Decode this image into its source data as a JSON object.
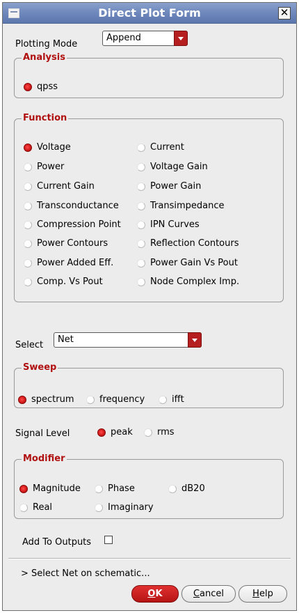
{
  "window": {
    "title": "Direct Plot Form",
    "close_glyph": "✕",
    "menu_icon": "window-menu-icon",
    "close_icon": "close-icon"
  },
  "plotting_mode": {
    "label": "Plotting Mode",
    "value": "Append"
  },
  "analysis": {
    "title": "Analysis",
    "options": [
      {
        "label": "qpss",
        "selected": true
      }
    ]
  },
  "function": {
    "title": "Function",
    "options": [
      {
        "label": "Voltage",
        "selected": true
      },
      {
        "label": "Current",
        "selected": false
      },
      {
        "label": "Power",
        "selected": false
      },
      {
        "label": "Voltage Gain",
        "selected": false
      },
      {
        "label": "Current Gain",
        "selected": false
      },
      {
        "label": "Power Gain",
        "selected": false
      },
      {
        "label": "Transconductance",
        "selected": false
      },
      {
        "label": "Transimpedance",
        "selected": false
      },
      {
        "label": "Compression Point",
        "selected": false
      },
      {
        "label": "IPN Curves",
        "selected": false
      },
      {
        "label": "Power Contours",
        "selected": false
      },
      {
        "label": "Reflection Contours",
        "selected": false
      },
      {
        "label": "Power Added Eff.",
        "selected": false
      },
      {
        "label": "Power Gain Vs Pout",
        "selected": false
      },
      {
        "label": "Comp. Vs Pout",
        "selected": false
      },
      {
        "label": "Node Complex Imp.",
        "selected": false
      }
    ]
  },
  "select": {
    "label": "Select",
    "value": "Net"
  },
  "sweep": {
    "title": "Sweep",
    "options": [
      {
        "label": "spectrum",
        "selected": true
      },
      {
        "label": "frequency",
        "selected": false
      },
      {
        "label": "ifft",
        "selected": false
      }
    ]
  },
  "signal_level": {
    "label": "Signal Level",
    "options": [
      {
        "label": "peak",
        "selected": true
      },
      {
        "label": "rms",
        "selected": false
      }
    ]
  },
  "modifier": {
    "title": "Modifier",
    "options": [
      {
        "label": "Magnitude",
        "selected": true
      },
      {
        "label": "Phase",
        "selected": false
      },
      {
        "label": "dB20",
        "selected": false
      },
      {
        "label": "Real",
        "selected": false
      },
      {
        "label": "Imaginary",
        "selected": false
      }
    ]
  },
  "add_to_outputs": {
    "label": "Add To Outputs",
    "checked": false
  },
  "status": "> Select Net on schematic...",
  "buttons": {
    "ok": {
      "label": "OK",
      "mnemonic": "O",
      "rest": "K"
    },
    "cancel": {
      "label": "Cancel",
      "mnemonic": "C",
      "rest": "ancel"
    },
    "help": {
      "label": "Help",
      "mnemonic": "H",
      "rest": "elp"
    }
  },
  "colors": {
    "title_bar": "#6e88bc",
    "accent_red": "#b61f1f",
    "group_title": "#b01010",
    "window_bg": "#ececec"
  }
}
